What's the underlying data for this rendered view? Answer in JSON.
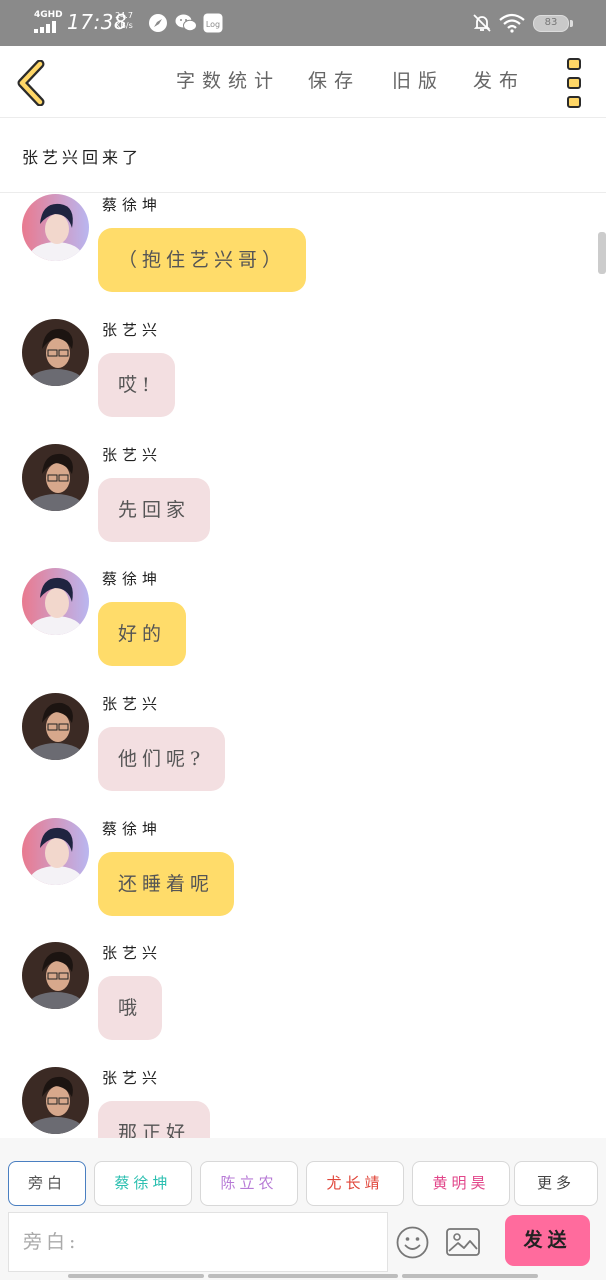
{
  "status_bar": {
    "network": "4GHD",
    "time": "17:38",
    "speed_value": "24.7",
    "speed_unit": "KB/s",
    "battery": "83",
    "icons": [
      "signal-icon",
      "compass-icon",
      "wechat-icon",
      "log-icon",
      "bell-off-icon",
      "wifi-icon",
      "battery-icon"
    ]
  },
  "header": {
    "back_icon": "chevron-left-icon",
    "actions": [
      "字数统计",
      "保存",
      "旧版",
      "发布"
    ],
    "more_icon": "more-vertical-icon",
    "accent_color": "#ffd767"
  },
  "title": "张艺兴回来了",
  "messages": [
    {
      "sender": "蔡徐坤",
      "avatar": "avatar-cai",
      "text": "（抱住艺兴哥）",
      "bubble_color": "#ffdc6a"
    },
    {
      "sender": "张艺兴",
      "avatar": "avatar-zhang",
      "text": "哎!",
      "bubble_color": "#f3dfe1"
    },
    {
      "sender": "张艺兴",
      "avatar": "avatar-zhang",
      "text": "先回家",
      "bubble_color": "#f3dfe1"
    },
    {
      "sender": "蔡徐坤",
      "avatar": "avatar-cai",
      "text": "好的",
      "bubble_color": "#ffdc6a"
    },
    {
      "sender": "张艺兴",
      "avatar": "avatar-zhang",
      "text": "他们呢?",
      "bubble_color": "#f3dfe1"
    },
    {
      "sender": "蔡徐坤",
      "avatar": "avatar-cai",
      "text": "还睡着呢",
      "bubble_color": "#ffdc6a"
    },
    {
      "sender": "张艺兴",
      "avatar": "avatar-zhang",
      "text": "哦",
      "bubble_color": "#f3dfe1"
    },
    {
      "sender": "张艺兴",
      "avatar": "avatar-zhang",
      "text": "那正好",
      "bubble_color": "#f3dfe1"
    }
  ],
  "roles": [
    {
      "label": "旁白",
      "color": "#555555",
      "selected": true
    },
    {
      "label": "蔡徐坤",
      "color": "#2bbfb0",
      "selected": false
    },
    {
      "label": "陈立农",
      "color": "#b77ad6",
      "selected": false
    },
    {
      "label": "尤长靖",
      "color": "#e0463a",
      "selected": false
    },
    {
      "label": "黄明昊",
      "color": "#e2468a",
      "selected": false
    },
    {
      "label": "更多",
      "color": "#444444",
      "selected": false
    }
  ],
  "input": {
    "placeholder": "旁白:"
  },
  "send_label": "发送",
  "send_color": "#ff6b9d"
}
